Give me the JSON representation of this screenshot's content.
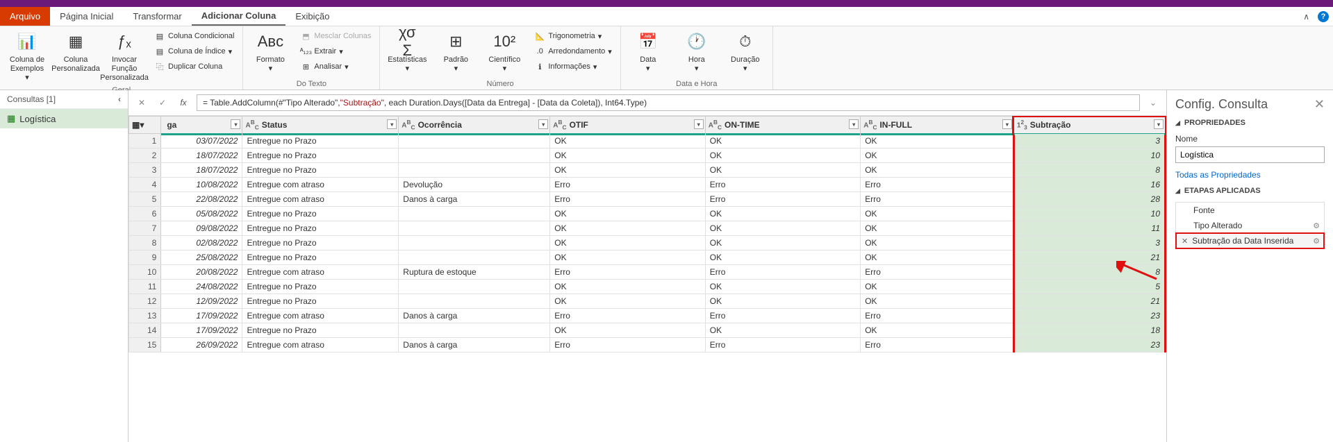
{
  "tabs": {
    "file": "Arquivo",
    "items": [
      "Página Inicial",
      "Transformar",
      "Adicionar Coluna",
      "Exibição"
    ],
    "active": 2
  },
  "ribbon": {
    "group_geral": {
      "label": "Geral",
      "col_from_examples": "Coluna de Exemplos",
      "custom_col": "Coluna Personalizada",
      "invoke_fn": "Invocar Função Personalizada",
      "cond_col": "Coluna Condicional",
      "index_col": "Coluna de Índice",
      "dup_col": "Duplicar Coluna"
    },
    "group_texto": {
      "label": "Do Texto",
      "format": "Formato",
      "merge": "Mesclar Colunas",
      "extract": "Extrair",
      "analyze": "Analisar"
    },
    "group_numero": {
      "label": "Número",
      "stats": "Estatísticas",
      "standard": "Padrão",
      "scientific": "Científico",
      "trig": "Trigonometria",
      "round": "Arredondamento",
      "info": "Informações"
    },
    "group_datahora": {
      "label": "Data e Hora",
      "date": "Data",
      "time": "Hora",
      "duration": "Duração"
    }
  },
  "queries": {
    "header": "Consultas [1]",
    "item": "Logística"
  },
  "formula": {
    "prefix": "= Table.AddColumn(#\"Tipo Alterado\", ",
    "str": "\"Subtração\"",
    "suffix": ", each Duration.Days([Data da Entrega] - [Data da Coleta]), Int64.Type)"
  },
  "columns": [
    "ga",
    "Status",
    "Ocorrência",
    "OTIF",
    "ON-TIME",
    "IN-FULL",
    "Subtração"
  ],
  "col_types": [
    "",
    "ABC",
    "ABC",
    "ABC",
    "ABC",
    "ABC",
    "123"
  ],
  "rows": [
    {
      "n": 1,
      "date": "03/07/2022",
      "status": "Entregue no Prazo",
      "occ": "",
      "otif": "OK",
      "ontime": "OK",
      "infull": "OK",
      "sub": 3
    },
    {
      "n": 2,
      "date": "18/07/2022",
      "status": "Entregue no Prazo",
      "occ": "",
      "otif": "OK",
      "ontime": "OK",
      "infull": "OK",
      "sub": 10
    },
    {
      "n": 3,
      "date": "18/07/2022",
      "status": "Entregue no Prazo",
      "occ": "",
      "otif": "OK",
      "ontime": "OK",
      "infull": "OK",
      "sub": 8
    },
    {
      "n": 4,
      "date": "10/08/2022",
      "status": "Entregue com atraso",
      "occ": "Devolução",
      "otif": "Erro",
      "ontime": "Erro",
      "infull": "Erro",
      "sub": 16
    },
    {
      "n": 5,
      "date": "22/08/2022",
      "status": "Entregue com atraso",
      "occ": "Danos à carga",
      "otif": "Erro",
      "ontime": "Erro",
      "infull": "Erro",
      "sub": 28
    },
    {
      "n": 6,
      "date": "05/08/2022",
      "status": "Entregue no Prazo",
      "occ": "",
      "otif": "OK",
      "ontime": "OK",
      "infull": "OK",
      "sub": 10
    },
    {
      "n": 7,
      "date": "09/08/2022",
      "status": "Entregue no Prazo",
      "occ": "",
      "otif": "OK",
      "ontime": "OK",
      "infull": "OK",
      "sub": 11
    },
    {
      "n": 8,
      "date": "02/08/2022",
      "status": "Entregue no Prazo",
      "occ": "",
      "otif": "OK",
      "ontime": "OK",
      "infull": "OK",
      "sub": 3
    },
    {
      "n": 9,
      "date": "25/08/2022",
      "status": "Entregue no Prazo",
      "occ": "",
      "otif": "OK",
      "ontime": "OK",
      "infull": "OK",
      "sub": 21
    },
    {
      "n": 10,
      "date": "20/08/2022",
      "status": "Entregue com atraso",
      "occ": "Ruptura de estoque",
      "otif": "Erro",
      "ontime": "Erro",
      "infull": "Erro",
      "sub": 8
    },
    {
      "n": 11,
      "date": "24/08/2022",
      "status": "Entregue no Prazo",
      "occ": "",
      "otif": "OK",
      "ontime": "OK",
      "infull": "OK",
      "sub": 5
    },
    {
      "n": 12,
      "date": "12/09/2022",
      "status": "Entregue no Prazo",
      "occ": "",
      "otif": "OK",
      "ontime": "OK",
      "infull": "OK",
      "sub": 21
    },
    {
      "n": 13,
      "date": "17/09/2022",
      "status": "Entregue com atraso",
      "occ": "Danos à carga",
      "otif": "Erro",
      "ontime": "Erro",
      "infull": "Erro",
      "sub": 23
    },
    {
      "n": 14,
      "date": "17/09/2022",
      "status": "Entregue no Prazo",
      "occ": "",
      "otif": "OK",
      "ontime": "OK",
      "infull": "OK",
      "sub": 18
    },
    {
      "n": 15,
      "date": "26/09/2022",
      "status": "Entregue com atraso",
      "occ": "Danos à carga",
      "otif": "Erro",
      "ontime": "Erro",
      "infull": "Erro",
      "sub": 23
    }
  ],
  "settings": {
    "title": "Config. Consulta",
    "props_head": "PROPRIEDADES",
    "name_label": "Nome",
    "name_value": "Logística",
    "all_props": "Todas as Propriedades",
    "steps_head": "ETAPAS APLICADAS",
    "steps": [
      "Fonte",
      "Tipo Alterado",
      "Subtração da Data Inserida"
    ],
    "active_step": 2
  }
}
